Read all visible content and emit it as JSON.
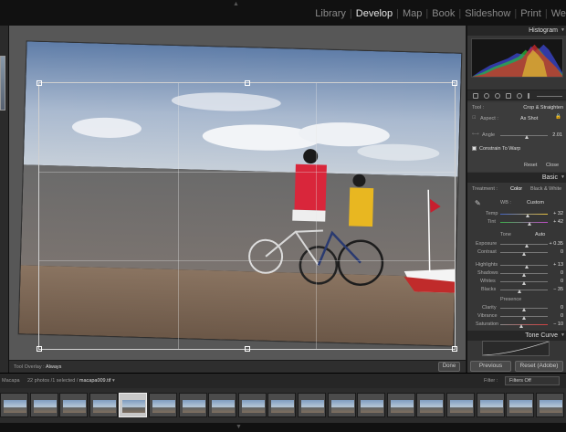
{
  "module_picker": {
    "items": [
      "Library",
      "Develop",
      "Map",
      "Book",
      "Slideshow",
      "Print",
      "We"
    ],
    "active": "Develop"
  },
  "histogram": {
    "title": "Histogram"
  },
  "crop_panel": {
    "tool_label": "Tool :",
    "tool_value": "Crop & Straighten",
    "aspect_label": "Aspect :",
    "aspect_value": "As Shot",
    "angle_label": "Angle",
    "angle_value": "2.01",
    "constrain_label": "Constrain To Warp",
    "reset_label": "Reset",
    "close_label": "Close"
  },
  "basic_panel": {
    "title": "Basic",
    "treatment_label": "Treatment :",
    "color_label": "Color",
    "bw_label": "Black & White",
    "wb_label": "WB :",
    "wb_value": "Custom",
    "temp_label": "Temp",
    "temp_value": "+ 32",
    "tint_label": "Tint",
    "tint_value": "+ 42",
    "tone_label": "Tone",
    "auto_label": "Auto",
    "exposure_label": "Exposure",
    "exposure_value": "+ 0.35",
    "contrast_label": "Contrast",
    "contrast_value": "0",
    "highlights_label": "Highlights",
    "highlights_value": "+ 13",
    "shadows_label": "Shadows",
    "shadows_value": "0",
    "whites_label": "Whites",
    "whites_value": "0",
    "blacks_label": "Blacks",
    "blacks_value": "− 35",
    "presence_label": "Presence",
    "clarity_label": "Clarity",
    "clarity_value": "0",
    "vibrance_label": "Vibrance",
    "vibrance_value": "0",
    "saturation_label": "Saturation",
    "saturation_value": "− 10"
  },
  "tone_curve": {
    "title": "Tone Curve"
  },
  "buttons": {
    "previous": "Previous",
    "reset": "Reset (Adobe)",
    "done": "Done"
  },
  "toolbar": {
    "overlay_label": "Tool Overlay :",
    "overlay_value": "Always"
  },
  "filmstrip": {
    "folder": "Macapa",
    "info": "22 photos /1 selected /",
    "filename": "macapa009.tif",
    "filter_label": "Filter :",
    "filter_value": "Filters Off",
    "selected_index": 4,
    "thumb_count": 19
  },
  "colors": {
    "accent": "#e6e6e6",
    "panel": "#363636",
    "canvas": "#575757"
  }
}
